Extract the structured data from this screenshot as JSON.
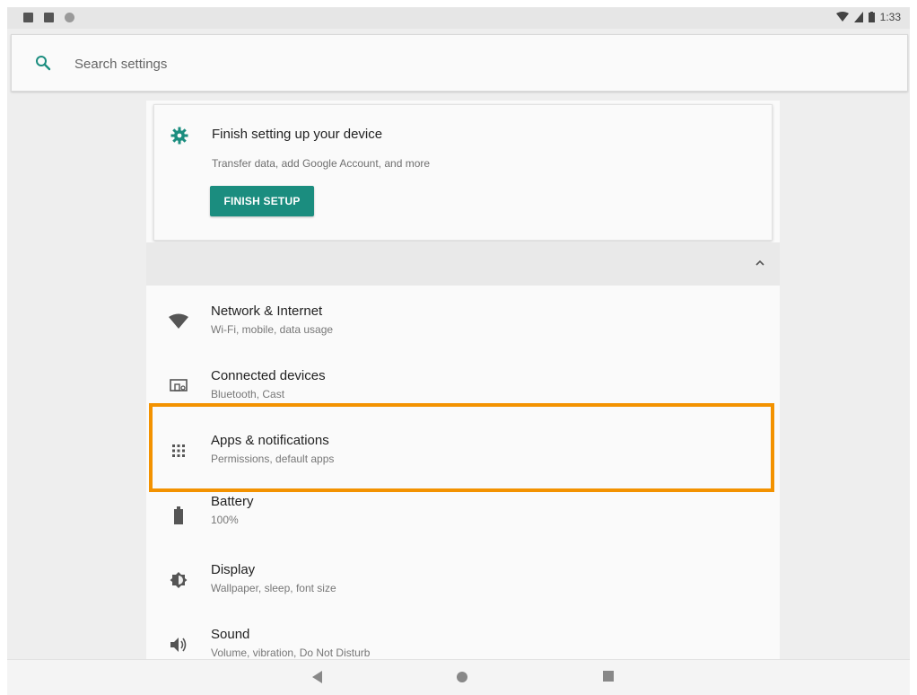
{
  "status_bar": {
    "time": "1:33",
    "left_icons": [
      "notification-a-icon",
      "sd-card-icon",
      "circle-status-icon"
    ],
    "right_icons": [
      "wifi-icon",
      "signal-icon",
      "battery-icon"
    ]
  },
  "search": {
    "placeholder": "Search settings"
  },
  "suggestion_card": {
    "title": "Finish setting up your device",
    "subtitle": "Transfer data, add Google Account, and more",
    "button_label": "FINISH SETUP",
    "icon": "gear-icon"
  },
  "settings_items": [
    {
      "title": "Network & Internet",
      "subtitle": "Wi-Fi, mobile, data usage",
      "icon": "wifi-icon"
    },
    {
      "title": "Connected devices",
      "subtitle": "Bluetooth, Cast",
      "icon": "devices-icon"
    },
    {
      "title": "Apps & notifications",
      "subtitle": "Permissions, default apps",
      "icon": "apps-grid-icon"
    },
    {
      "title": "Battery",
      "subtitle": "100%",
      "icon": "battery-icon"
    },
    {
      "title": "Display",
      "subtitle": "Wallpaper, sleep, font size",
      "icon": "brightness-icon"
    },
    {
      "title": "Sound",
      "subtitle": "Volume, vibration, Do Not Disturb",
      "icon": "volume-icon"
    }
  ],
  "colors": {
    "accent": "#1b8d7f",
    "highlight": "#f39200"
  },
  "nav_bar": {
    "buttons": [
      "back-icon",
      "home-icon",
      "recents-icon"
    ]
  }
}
